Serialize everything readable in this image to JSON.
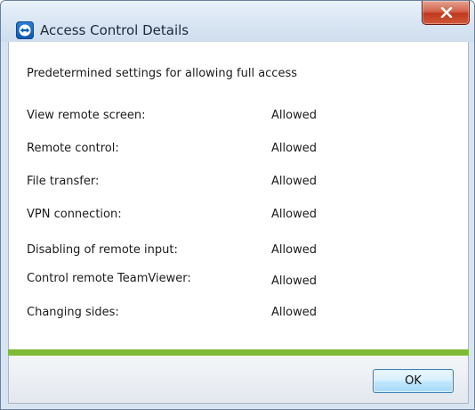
{
  "window": {
    "title": "Access Control Details",
    "icon": "teamviewer-icon",
    "close_icon": "close-icon"
  },
  "content": {
    "heading": "Predetermined settings for allowing full access",
    "rows": [
      {
        "label": "View remote screen:",
        "value": "Allowed"
      },
      {
        "label": "Remote control:",
        "value": "Allowed"
      },
      {
        "label": "File transfer:",
        "value": "Allowed"
      },
      {
        "label": "VPN connection:",
        "value": "Allowed"
      },
      {
        "label": "Disabling of remote input:",
        "value": "Allowed"
      },
      {
        "label": "Control remote TeamViewer:",
        "value": "Allowed"
      },
      {
        "label": "Changing sides:",
        "value": "Allowed"
      }
    ]
  },
  "footer": {
    "ok_label": "OK"
  },
  "colors": {
    "accent_bar": "#7fba36",
    "close_button": "#c0381d"
  }
}
